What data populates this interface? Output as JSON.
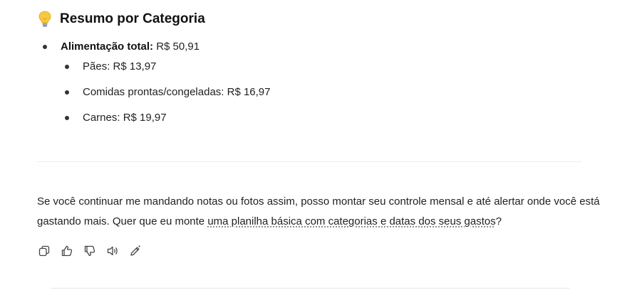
{
  "heading": {
    "icon": "lightbulb-icon",
    "title": "Resumo por Categoria"
  },
  "summary": {
    "total": {
      "label": "Alimentação total:",
      "value": " R$ 50,91"
    },
    "items": [
      {
        "text": "Pães: R$ 13,97"
      },
      {
        "text": "Comidas prontas/congeladas: R$ 16,97"
      },
      {
        "text": "Carnes: R$ 19,97"
      }
    ]
  },
  "message": {
    "text_before": "Se você continuar me mandando notas ou fotos assim, posso montar seu controle mensal e até alertar onde você está gastando mais. Quer que eu monte ",
    "link_text": "uma planilha básica com categorias e datas dos seus gastos",
    "text_after": "?"
  },
  "actions": [
    {
      "icon": "copy-icon"
    },
    {
      "icon": "thumbs-up-icon"
    },
    {
      "icon": "thumbs-down-icon"
    },
    {
      "icon": "speaker-icon"
    },
    {
      "icon": "edit-wand-icon"
    }
  ],
  "colors": {
    "text": "#222222",
    "bulb": "#f5c518"
  }
}
